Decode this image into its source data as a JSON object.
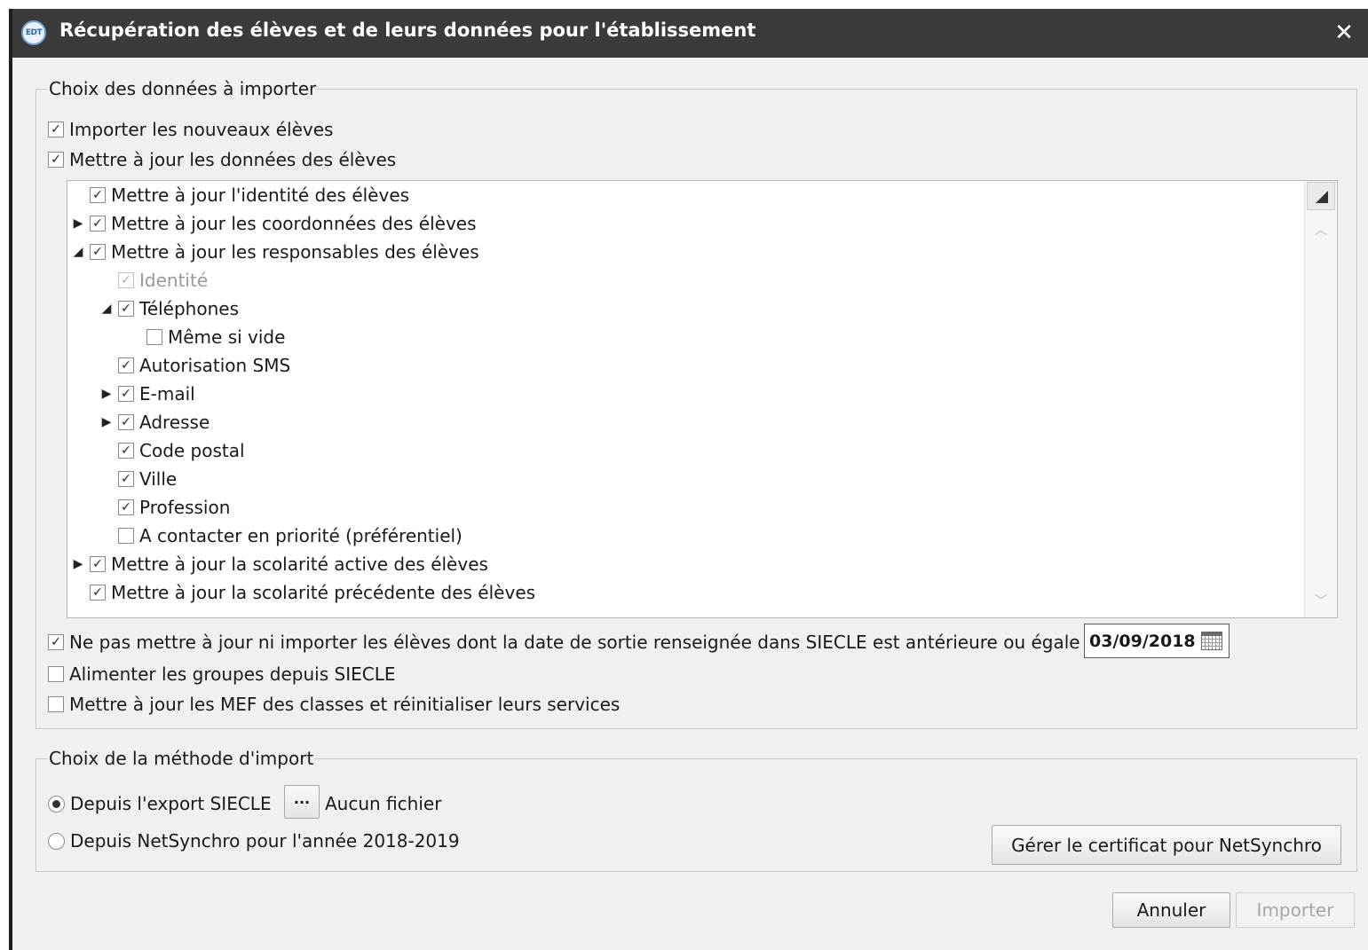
{
  "window": {
    "logo_text": "EDT",
    "title": "Récupération des élèves et de leurs données pour l'établissement",
    "close_glyph": "✕"
  },
  "data_section": {
    "legend": "Choix des données à importer",
    "import_new": {
      "label": "Importer les nouveaux élèves",
      "checked": true
    },
    "update_data": {
      "label": "Mettre à jour les données des élèves",
      "checked": true
    },
    "tree": [
      {
        "label": "Mettre à jour l'identité des élèves",
        "checked": true
      },
      {
        "label": "Mettre à jour les coordonnées des élèves",
        "checked": true,
        "expander": "collapsed"
      },
      {
        "label": "Mettre à jour les responsables des élèves",
        "checked": true,
        "expander": "expanded"
      },
      {
        "label": "Identité",
        "checked": true,
        "disabled": true
      },
      {
        "label": "Téléphones",
        "checked": true,
        "expander": "expanded"
      },
      {
        "label": "Même si vide",
        "checked": false
      },
      {
        "label": "Autorisation SMS",
        "checked": true
      },
      {
        "label": "E-mail",
        "checked": true,
        "expander": "collapsed"
      },
      {
        "label": "Adresse",
        "checked": true,
        "expander": "collapsed"
      },
      {
        "label": "Code postal",
        "checked": true
      },
      {
        "label": "Ville",
        "checked": true
      },
      {
        "label": "Profession",
        "checked": true
      },
      {
        "label": "A contacter en priorité (préférentiel)",
        "checked": false
      },
      {
        "label": "Mettre à jour la scolarité active des élèves",
        "checked": true,
        "expander": "collapsed"
      },
      {
        "label": "Mettre à jour la scolarité précédente des élèves",
        "checked": true
      }
    ],
    "skip_exited": {
      "label": "Ne pas mettre à jour ni importer les élèves dont la date de sortie renseignée dans SIECLE est antérieure ou égale au",
      "checked": true,
      "date": "03/09/2018"
    },
    "feed_groups": {
      "label": "Alimenter les groupes depuis SIECLE",
      "checked": false
    },
    "update_mef": {
      "label": "Mettre à jour les MEF des classes et réinitialiser leurs services",
      "checked": false
    }
  },
  "method_section": {
    "legend": "Choix de la méthode d'import",
    "from_siecle": {
      "label": "Depuis l'export SIECLE",
      "selected": true
    },
    "browse_label": "···",
    "file_status": "Aucun fichier",
    "from_netsynchro": {
      "label": "Depuis NetSynchro pour l'année 2018-2019",
      "selected": false
    },
    "certificate_button": "Gérer le certificat pour NetSynchro"
  },
  "footer": {
    "cancel": "Annuler",
    "import": "Importer"
  },
  "icons": {
    "check_glyph": "✓",
    "expand_collapsed": "▶",
    "expand_expanded": "◢",
    "scroll_up": "︿",
    "scroll_down": "﹀"
  },
  "colors": {
    "titlebar": "#3b3b3b",
    "dialog_bg": "#f0f0f0"
  }
}
